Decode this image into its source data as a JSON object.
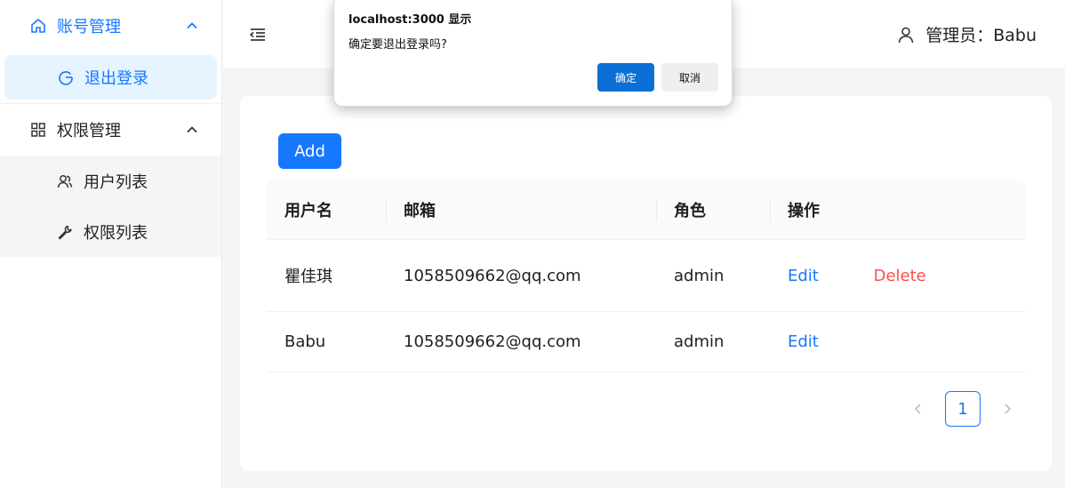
{
  "sidebar": {
    "groups": [
      {
        "label": "账号管理",
        "icon": "home-icon",
        "expanded": true,
        "items": [
          {
            "label": "退出登录",
            "icon": "logout-icon",
            "selected": true
          }
        ]
      },
      {
        "label": "权限管理",
        "icon": "appstore-icon",
        "expanded": true,
        "items": [
          {
            "label": "用户列表",
            "icon": "users-icon"
          },
          {
            "label": "权限列表",
            "icon": "wrench-icon"
          }
        ]
      }
    ]
  },
  "header": {
    "user_label": "管理员：Babu"
  },
  "toolbar": {
    "add_label": "Add"
  },
  "table": {
    "columns": [
      "用户名",
      "邮箱",
      "角色",
      "操作"
    ],
    "rows": [
      {
        "username": "瞿佳琪",
        "email": "1058509662@qq.com",
        "role": "admin",
        "edit": "Edit",
        "delete": "Delete"
      },
      {
        "username": "Babu",
        "email": "1058509662@qq.com",
        "role": "admin",
        "edit": "Edit"
      }
    ]
  },
  "pagination": {
    "current": "1"
  },
  "dialog": {
    "title": "localhost:3000 显示",
    "message": "确定要退出登录吗?",
    "ok_label": "确定",
    "cancel_label": "取消"
  },
  "colors": {
    "primary": "#1677ff",
    "danger": "#ff4d4f",
    "selected_bg": "#e6f4ff",
    "dialog_ok": "#0b6fd6"
  }
}
